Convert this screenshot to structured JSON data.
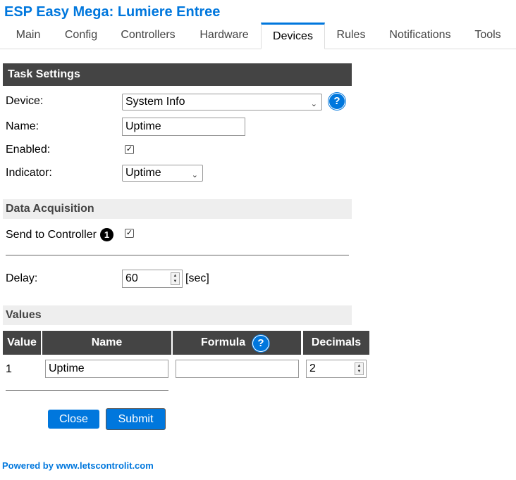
{
  "app_title": "ESP Easy Mega: Lumiere Entree",
  "nav": {
    "tabs": [
      "Main",
      "Config",
      "Controllers",
      "Hardware",
      "Devices",
      "Rules",
      "Notifications",
      "Tools"
    ],
    "active": "Devices"
  },
  "task_settings": {
    "header": "Task Settings",
    "device_label": "Device:",
    "device_value": "System Info",
    "name_label": "Name:",
    "name_value": "Uptime",
    "enabled_label": "Enabled:",
    "enabled_checked": true,
    "indicator_label": "Indicator:",
    "indicator_value": "Uptime",
    "help_glyph": "?"
  },
  "data_acquisition": {
    "header": "Data Acquisition",
    "send_label": "Send to Controller",
    "controller_number": "1",
    "send_checked": true,
    "delay_label": "Delay:",
    "delay_value": "60",
    "delay_unit": "[sec]"
  },
  "values": {
    "header": "Values",
    "columns": [
      "Value",
      "Name",
      "Formula",
      "Decimals"
    ],
    "rows": [
      {
        "index": "1",
        "name": "Uptime",
        "formula": "",
        "decimals": "2"
      }
    ]
  },
  "buttons": {
    "close": "Close",
    "submit": "Submit"
  },
  "footer": "Powered by www.letscontrolit.com",
  "colors": {
    "accent": "#0077dd",
    "dark_header": "#444444",
    "light_header": "#eeeeee"
  },
  "icons": {
    "help": "question-circle-icon",
    "dropdown": "chevron-down-icon",
    "check": "checkbox-checked-icon"
  }
}
